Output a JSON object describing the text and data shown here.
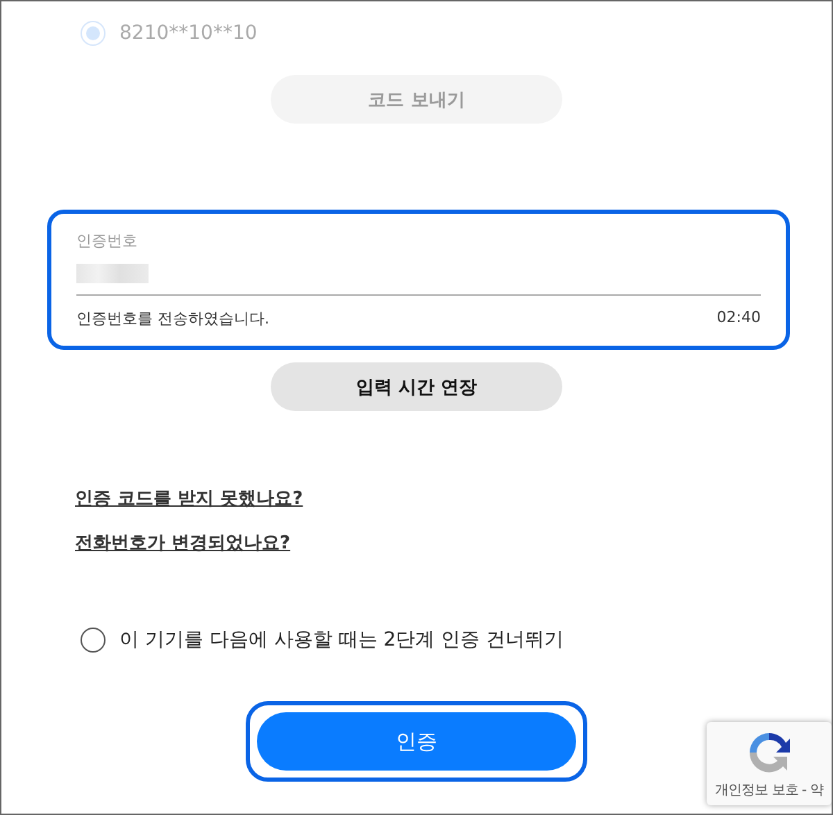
{
  "phone_option": {
    "label": "8210**10**10",
    "selected": true,
    "disabled": true
  },
  "send_code_button": {
    "label": "코드 보내기",
    "disabled": true
  },
  "code_field": {
    "label": "인증번호",
    "focused": true,
    "helper": "인증번호를 전송하였습니다.",
    "timer": "02:40"
  },
  "extend_button": {
    "label": "입력 시간 연장"
  },
  "links": [
    "인증 코드를 받지 못했나요?",
    "전화번호가 변경되었나요?"
  ],
  "skip_option": {
    "label": "이 기기를 다음에 사용할 때는 2단계 인증 건너뛰기",
    "selected": false
  },
  "verify_button": {
    "label": "인증",
    "focused": true
  },
  "recaptcha_badge": {
    "text": "개인정보 보호 - 약"
  }
}
